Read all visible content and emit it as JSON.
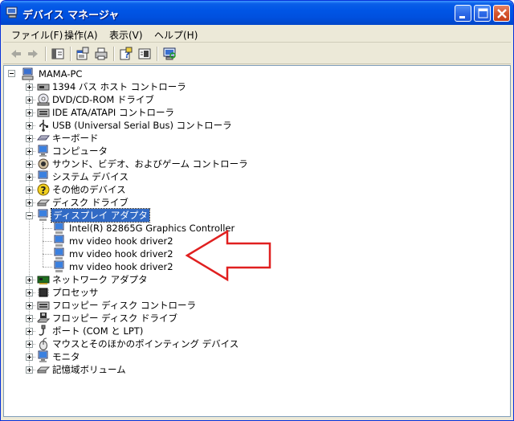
{
  "window": {
    "title": "デバイス マネージャ"
  },
  "menu": [
    {
      "label": "ファイル(F)"
    },
    {
      "label": "操作(A)"
    },
    {
      "label": "表示(V)"
    },
    {
      "label": "ヘルプ(H)"
    }
  ],
  "toolbar": {
    "icons": [
      "back-arrow-icon",
      "forward-arrow-icon",
      "show-hide-tree-icon",
      "properties-icon",
      "print-icon",
      "help-icon",
      "view-panel-icon",
      "scan-hardware-icon"
    ]
  },
  "tree": {
    "root": "MAMA-PC",
    "categories": [
      {
        "label": "1394 バス ホスト コントローラ",
        "icon": "firewire-controller-icon"
      },
      {
        "label": "DVD/CD-ROM ドライブ",
        "icon": "cdrom-drive-icon"
      },
      {
        "label": "IDE ATA/ATAPI コントローラ",
        "icon": "ide-controller-icon"
      },
      {
        "label": "USB (Universal Serial Bus) コントローラ",
        "icon": "usb-controller-icon"
      },
      {
        "label": "キーボード",
        "icon": "keyboard-icon"
      },
      {
        "label": "コンピュータ",
        "icon": "computer-icon"
      },
      {
        "label": "サウンド、ビデオ、およびゲーム コントローラ",
        "icon": "sound-video-icon"
      },
      {
        "label": "システム デバイス",
        "icon": "system-device-icon"
      },
      {
        "label": "その他のデバイス",
        "icon": "unknown-device-icon"
      },
      {
        "label": "ディスク ドライブ",
        "icon": "disk-drive-icon"
      },
      {
        "label": "ディスプレイ アダプタ",
        "icon": "display-adapter-icon",
        "selected": true,
        "expanded": true,
        "children": [
          {
            "label": "Intel(R) 82865G Graphics Controller"
          },
          {
            "label": "mv video hook driver2"
          },
          {
            "label": "mv video hook driver2"
          },
          {
            "label": "mv video hook driver2"
          }
        ]
      },
      {
        "label": "ネットワーク アダプタ",
        "icon": "network-adapter-icon"
      },
      {
        "label": "プロセッサ",
        "icon": "processor-icon"
      },
      {
        "label": "フロッピー ディスク コントローラ",
        "icon": "floppy-controller-icon"
      },
      {
        "label": "フロッピー ディスク ドライブ",
        "icon": "floppy-drive-icon"
      },
      {
        "label": "ポート (COM と LPT)",
        "icon": "port-icon"
      },
      {
        "label": "マウスとそのほかのポインティング デバイス",
        "icon": "mouse-icon"
      },
      {
        "label": "モニタ",
        "icon": "monitor-icon"
      },
      {
        "label": "記憶域ボリューム",
        "icon": "storage-volume-icon"
      }
    ]
  },
  "annotation": {
    "color": "#e02020"
  }
}
